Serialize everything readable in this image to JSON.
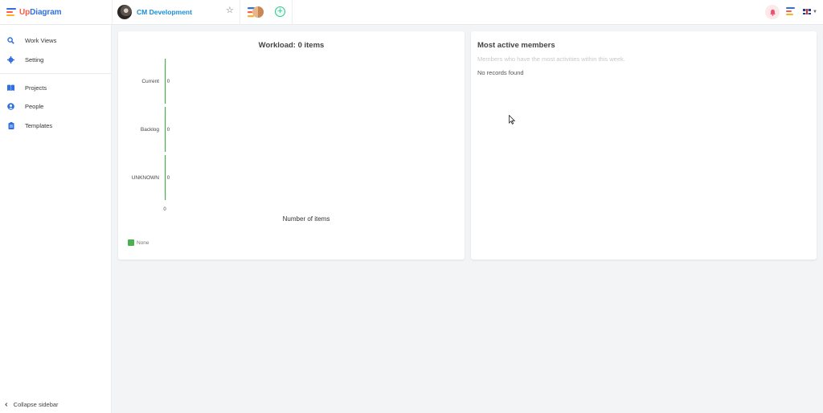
{
  "app": {
    "logo_part1": "Up",
    "logo_part2": "Diagram"
  },
  "header": {
    "project_name": "CM Development"
  },
  "sidebar": {
    "items": [
      {
        "label": "Work Views",
        "icon": "search-icon"
      },
      {
        "label": "Setting",
        "icon": "gear-icon"
      },
      {
        "label": "Projects",
        "icon": "book-icon"
      },
      {
        "label": "People",
        "icon": "person-icon"
      },
      {
        "label": "Templates",
        "icon": "clipboard-icon"
      }
    ],
    "collapse_label": "Collapse sidebar"
  },
  "workload": {
    "title": "Workload: 0 items"
  },
  "chart_data": {
    "type": "bar",
    "orientation": "horizontal",
    "categories": [
      "Current",
      "Backlog",
      "UNKNOWN"
    ],
    "series": [
      {
        "name": "None",
        "values": [
          0,
          0,
          0
        ],
        "color": "#4caf50"
      }
    ],
    "data_labels": [
      "0",
      "0",
      "0"
    ],
    "x_ticks": [
      "0"
    ],
    "xlabel": "Number of items",
    "ylabel": "",
    "legend_position": "bottom-left",
    "grid": false
  },
  "members": {
    "title": "Most active members",
    "subtitle": "Members who have the most activities within this week.",
    "empty": "No records found"
  },
  "colors": {
    "brand_blue": "#2f6fe0",
    "brand_red": "#ff5a46",
    "link_blue": "#1a8ed1",
    "series_green": "#4caf50",
    "add_green": "#34c38f",
    "background": "#f2f4f5"
  }
}
